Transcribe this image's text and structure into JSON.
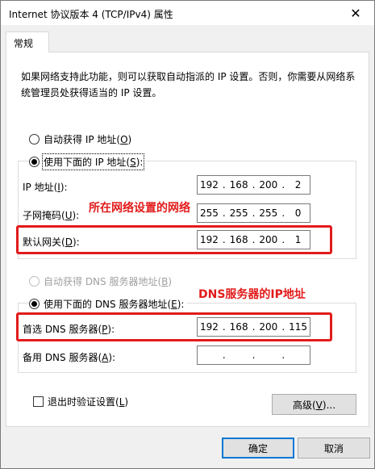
{
  "window": {
    "title": "Internet 协议版本 4 (TCP/IPv4) 属性",
    "close_glyph": "✕"
  },
  "tabs": [
    {
      "label": "常规"
    }
  ],
  "description": "如果网络支持此功能，则可以获取自动指派的 IP 设置。否则，你需要从网络系统管理员处获得适当的 IP 设置。",
  "ip_section": {
    "auto_radio": {
      "text": "自动获得 IP 地址(",
      "key": "O",
      "suffix": ")"
    },
    "manual_radio": {
      "text": "使用下面的 IP 地址(",
      "key": "S",
      "suffix": "):"
    },
    "fields": [
      {
        "label": "IP 地址(",
        "key": "I",
        "suffix": "):",
        "octets": [
          "192",
          "168",
          "200",
          "2"
        ]
      },
      {
        "label": "子网掩码(",
        "key": "U",
        "suffix": "):",
        "octets": [
          "255",
          "255",
          "255",
          "0"
        ]
      },
      {
        "label": "默认网关(",
        "key": "D",
        "suffix": "):",
        "octets": [
          "192",
          "168",
          "200",
          "1"
        ]
      }
    ]
  },
  "dns_section": {
    "auto_radio": {
      "text": "自动获得 DNS 服务器地址(",
      "key": "B",
      "suffix": ")"
    },
    "manual_radio": {
      "text": "使用下面的 DNS 服务器地址(",
      "key": "E",
      "suffix": "):"
    },
    "fields": [
      {
        "label": "首选 DNS 服务器(",
        "key": "P",
        "suffix": "):",
        "octets": [
          "192",
          "168",
          "200",
          "115"
        ]
      },
      {
        "label": "备用 DNS 服务器(",
        "key": "A",
        "suffix": "):",
        "octets": [
          "",
          "",
          "",
          ""
        ]
      }
    ]
  },
  "annotations": {
    "network": "所在网络设置的网络",
    "dns": "DNS服务器的IP地址"
  },
  "validate_checkbox": {
    "text": "退出时验证设置(",
    "key": "L",
    "suffix": ")"
  },
  "buttons": {
    "advanced": {
      "text": "高级(",
      "key": "V",
      "suffix": ")..."
    },
    "ok": "确定",
    "cancel": "取消"
  },
  "colors": {
    "annotation": "#e21b1b",
    "focus_border": "#0078d7"
  }
}
